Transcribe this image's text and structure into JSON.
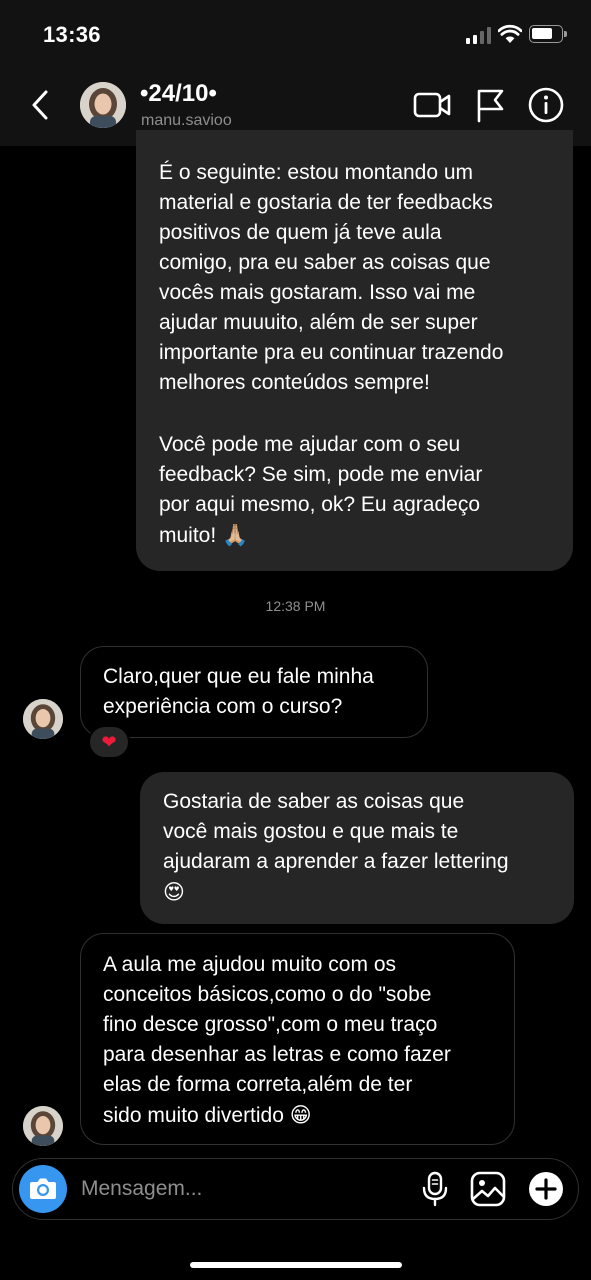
{
  "status_bar": {
    "time": "13:36",
    "icons": [
      "cellular-signal-icon",
      "wifi-icon",
      "battery-icon"
    ]
  },
  "header": {
    "title": "•24/10•",
    "username": "manu.savioo",
    "icons": [
      "back-chevron-icon",
      "video-call-icon",
      "flag-icon",
      "info-icon"
    ]
  },
  "messages": [
    {
      "direction": "outgoing",
      "paragraphs": [
        "É o seguinte: estou montando um\nmaterial e gostaria de ter feedbacks\npositivos de quem já teve aula\ncomigo, pra eu saber as coisas que\nvocês mais gostaram. Isso vai me\najudar muuuito, além de ser super\nimportante pra eu continuar trazendo\nmelhores conteúdos sempre!",
        "Você pode me ajudar com o seu\nfeedback? Se sim, pode me enviar\npor aqui mesmo, ok? Eu agradeço\nmuito!"
      ],
      "emoji": "🙏🏼"
    },
    {
      "direction": "incoming",
      "text": "Claro,quer que eu fale minha\nexperiência com o curso?",
      "reaction": "❤"
    },
    {
      "direction": "outgoing",
      "text": "Gostaria de saber as coisas que\nvocê mais gostou e que mais te\najudaram a aprender a fazer lettering",
      "emoji": "😍"
    },
    {
      "direction": "incoming",
      "text": "A aula me ajudou muito com os\nconceitos básicos,como o do \"sobe\nfino desce grosso\",com o meu traço\npara desenhar as letras e como fazer\nelas de forma correta,além de ter\nsido muito divertido",
      "emoji": "😁"
    }
  ],
  "timestamp": "12:38 PM",
  "composer": {
    "placeholder": "Mensagem...",
    "icons": [
      "camera-icon",
      "microphone-icon",
      "gallery-icon",
      "plus-icon"
    ]
  },
  "colors": {
    "background": "#000000",
    "header_bg": "#121212",
    "outgoing_bubble": "#262626",
    "incoming_border": "#303030",
    "camera_button": "#3797f0",
    "secondary_text": "#8e8e8e"
  }
}
